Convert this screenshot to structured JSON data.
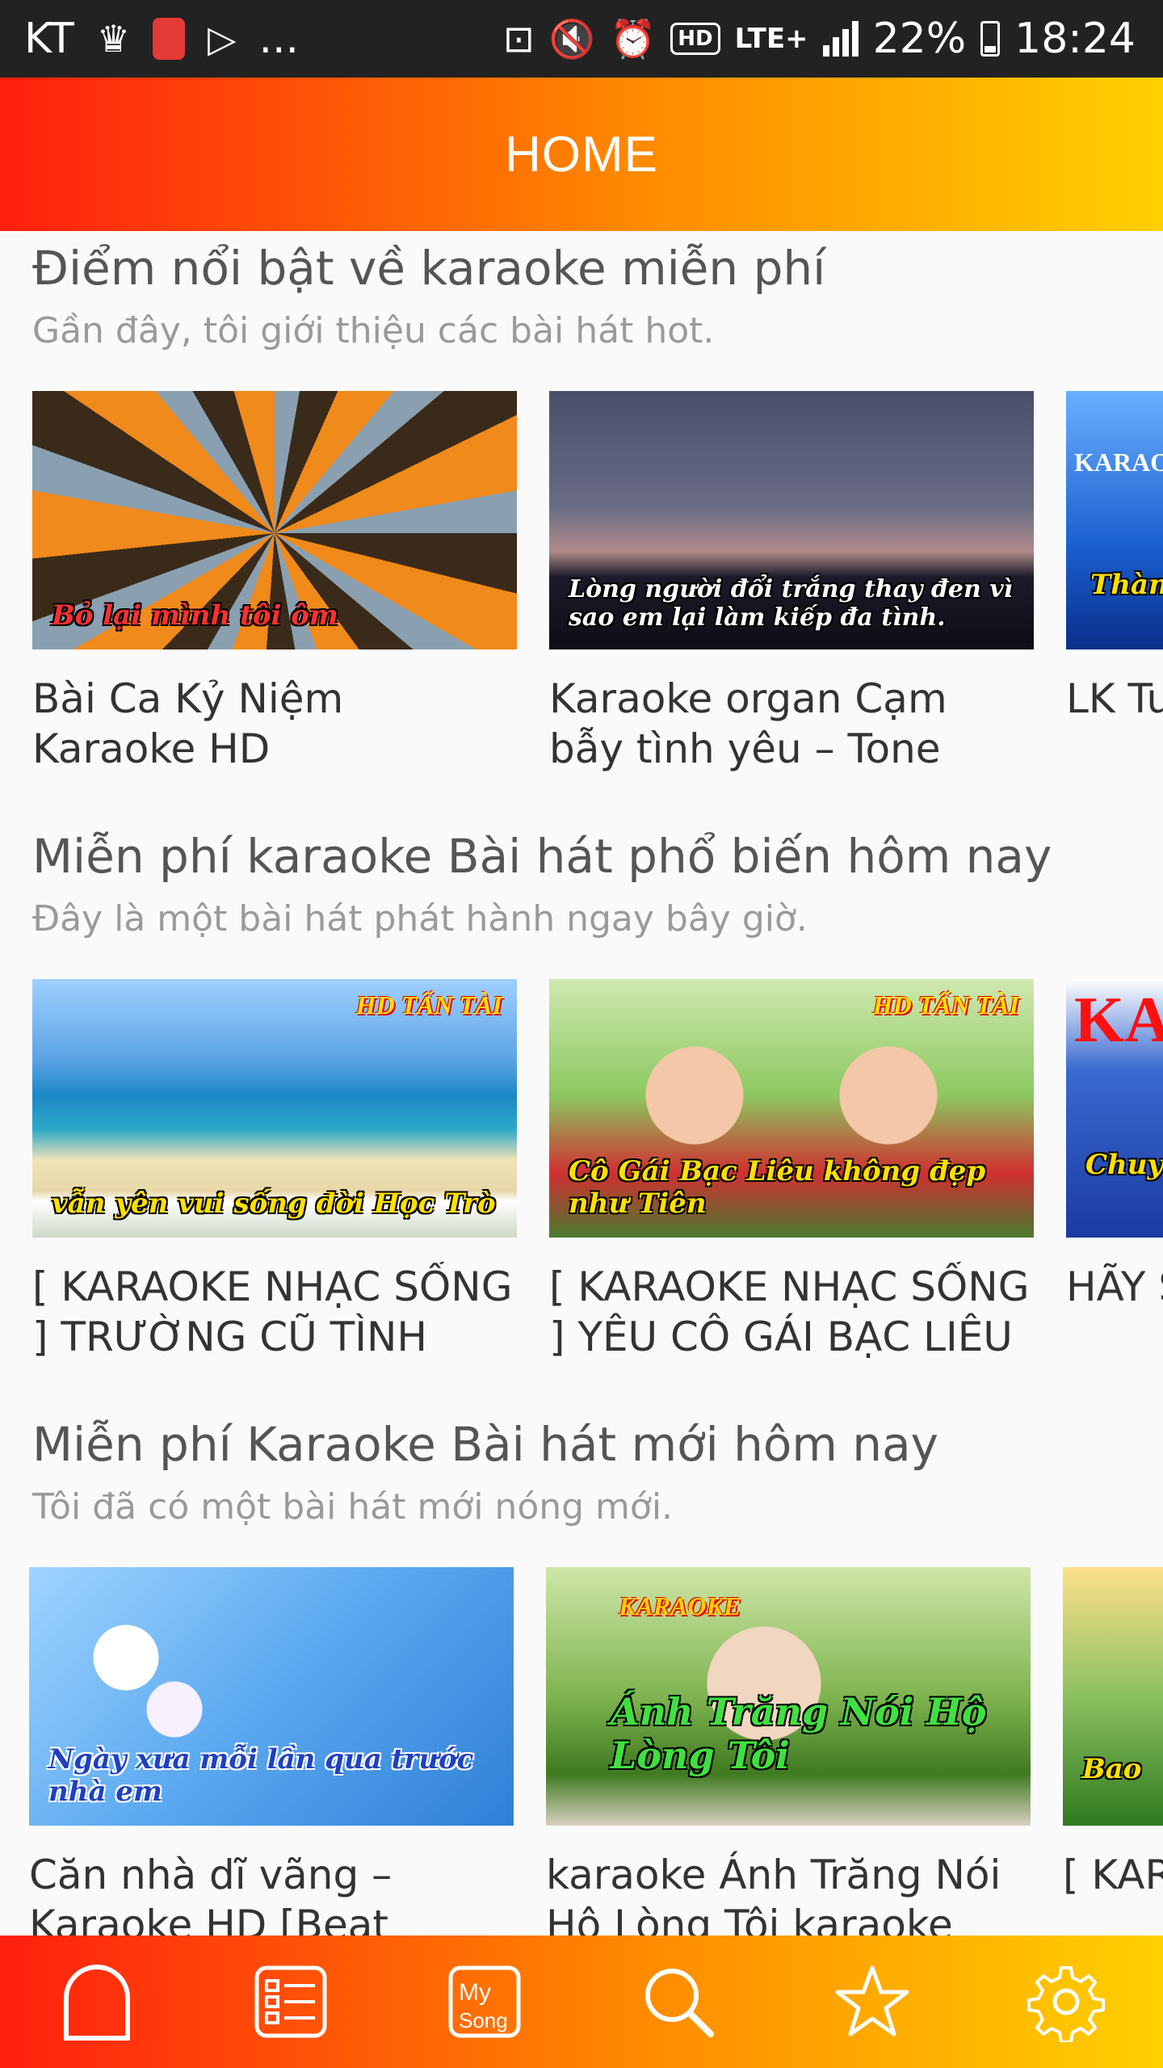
{
  "status_bar": {
    "carrier": "KT",
    "more": "...",
    "network": "LTE+",
    "hd": "HD",
    "battery": "22%",
    "time": "18:24"
  },
  "app_bar": {
    "title": "HOME"
  },
  "sections": [
    {
      "title": "Điểm nổi bật về karaoke miễn phí",
      "subtitle": "Gần đây, tôi giới thiệu các bài hát hot.",
      "items": [
        {
          "title": "Bài Ca Kỷ Niệm   Karaoke HD",
          "caption": "Bỏ lại mình tôi ôm",
          "label": ""
        },
        {
          "title": "Karaoke organ Cạm bẫy tình yêu – Tone nam –",
          "caption": "Lòng người đổi trắng thay đen vì sao em lại làm kiếp đa tình.",
          "label": ""
        },
        {
          "title": "LK Tu Nhạc",
          "caption": "Thành",
          "label": "KARAOKE"
        }
      ]
    },
    {
      "title": "Miễn phí karaoke Bài hát phổ biến hôm nay",
      "subtitle": "Đây là một bài hát phát hành ngay bây giờ.",
      "items": [
        {
          "title": "[ KARAOKE NHẠC SỐNG ] TRƯỜNG CŨ TÌNH XƯA",
          "caption": "vẫn yên vui sống đời Học Trò",
          "label": "HD TẤN TÀI"
        },
        {
          "title": "[ KARAOKE NHẠC SỐNG ] YÊU CÔ GÁI BẠC LIÊU",
          "caption": "Cô Gái Bạc Liêu không đẹp như Tiên",
          "label": "HD TẤN TÀI"
        },
        {
          "title": "HÃY S TRẺ [",
          "caption": "Chuyệ",
          "label": "KA"
        }
      ]
    },
    {
      "title": "Miễn phí Karaoke Bài hát mới hôm nay",
      "subtitle": "Tôi đã có một bài hát mới nóng mới.",
      "items": [
        {
          "title": "Căn nhà dĩ vãng – Karaoke HD [Beat",
          "caption": "Ngày xưa mỗi lần qua trước nhà em",
          "label": ""
        },
        {
          "title": "karaoke Ánh Trăng Nói Hộ Lòng Tôi karaoke",
          "caption": "Ánh Trăng Nói Hộ Lòng Tôi",
          "label": "KARAOKE"
        },
        {
          "title": "[ KAR ] BÓN",
          "caption": "Bao",
          "label": ""
        }
      ]
    }
  ],
  "bottom_nav": [
    {
      "name": "home-nav-button",
      "icon": "home-icon"
    },
    {
      "name": "list-nav-button",
      "icon": "list-icon"
    },
    {
      "name": "my-song-nav-button",
      "icon": "my-song-icon",
      "label": "My Song"
    },
    {
      "name": "search-nav-button",
      "icon": "search-icon"
    },
    {
      "name": "favorites-nav-button",
      "icon": "star-icon"
    },
    {
      "name": "settings-nav-button",
      "icon": "gear-icon"
    }
  ]
}
